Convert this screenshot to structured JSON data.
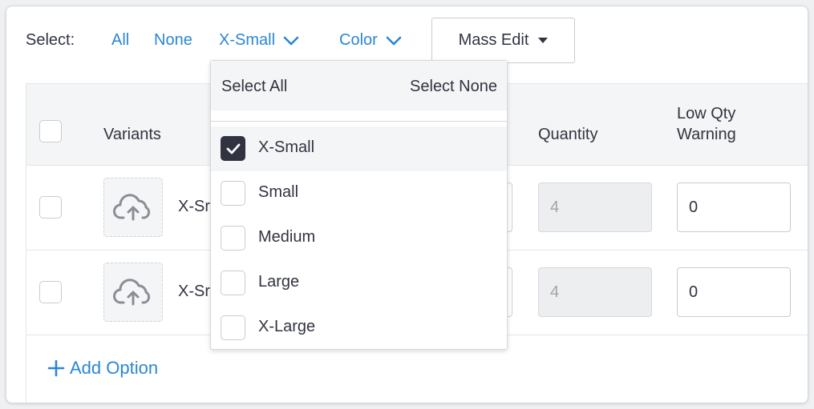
{
  "toolbar": {
    "select_label": "Select:",
    "links": {
      "all": "All",
      "none": "None",
      "size": "X-Small",
      "color": "Color"
    },
    "mass_edit": "Mass Edit"
  },
  "table": {
    "headers": {
      "variants": "Variants",
      "quantity": "Quantity",
      "low_qty_line1": "Low Qty",
      "low_qty_line2": "Warning"
    },
    "rows": [
      {
        "variant": "X-Sr",
        "quantity": "4",
        "low_qty_warning": "0"
      },
      {
        "variant": "X-Sr",
        "quantity": "4",
        "low_qty_warning": "0"
      }
    ],
    "add_option": "Add Option"
  },
  "dropdown": {
    "select_all": "Select All",
    "select_none": "Select None",
    "items": [
      {
        "label": "X-Small",
        "checked": true
      },
      {
        "label": "Small",
        "checked": false
      },
      {
        "label": "Medium",
        "checked": false
      },
      {
        "label": "Large",
        "checked": false
      },
      {
        "label": "X-Large",
        "checked": false
      }
    ]
  },
  "colors": {
    "link": "#2b86d6",
    "text": "#313440",
    "header_bg": "#f4f5f6"
  }
}
